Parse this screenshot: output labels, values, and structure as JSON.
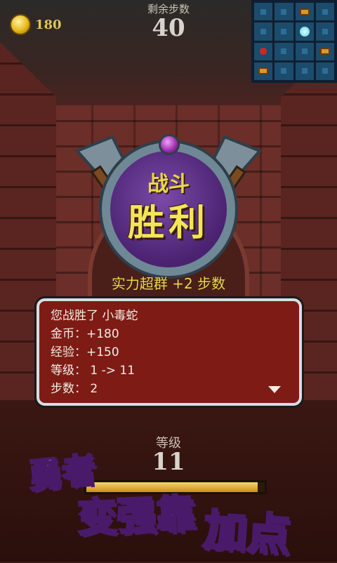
{
  "hud": {
    "coins": "180",
    "steps_label": "剩余步数",
    "steps_value": "40"
  },
  "minimap": {
    "cells": [
      "empty",
      "empty",
      "chest",
      "empty",
      "empty",
      "empty",
      "player",
      "empty",
      "enemy",
      "empty",
      "empty",
      "chest",
      "chest",
      "empty",
      "empty",
      "empty"
    ]
  },
  "victory": {
    "battle": "战斗",
    "result": "胜利",
    "bonus": "实力超群 +2 步数"
  },
  "dialog": {
    "line1": "您战胜了 小毒蛇",
    "line2": "金币：+180",
    "line3": "经验：+150",
    "line4": "等级：  1 -> 11",
    "line5": "步数：  2"
  },
  "level": {
    "label": "等级",
    "value": "11",
    "xp_fraction": 0.96
  },
  "slogan": {
    "part1": "勇者",
    "part2": "变强靠",
    "part3": "加点"
  },
  "colors": {
    "accent_gold": "#e8d84a",
    "dialog_bg": "#7e1b14",
    "minimap_bg": "#0e1f33"
  }
}
